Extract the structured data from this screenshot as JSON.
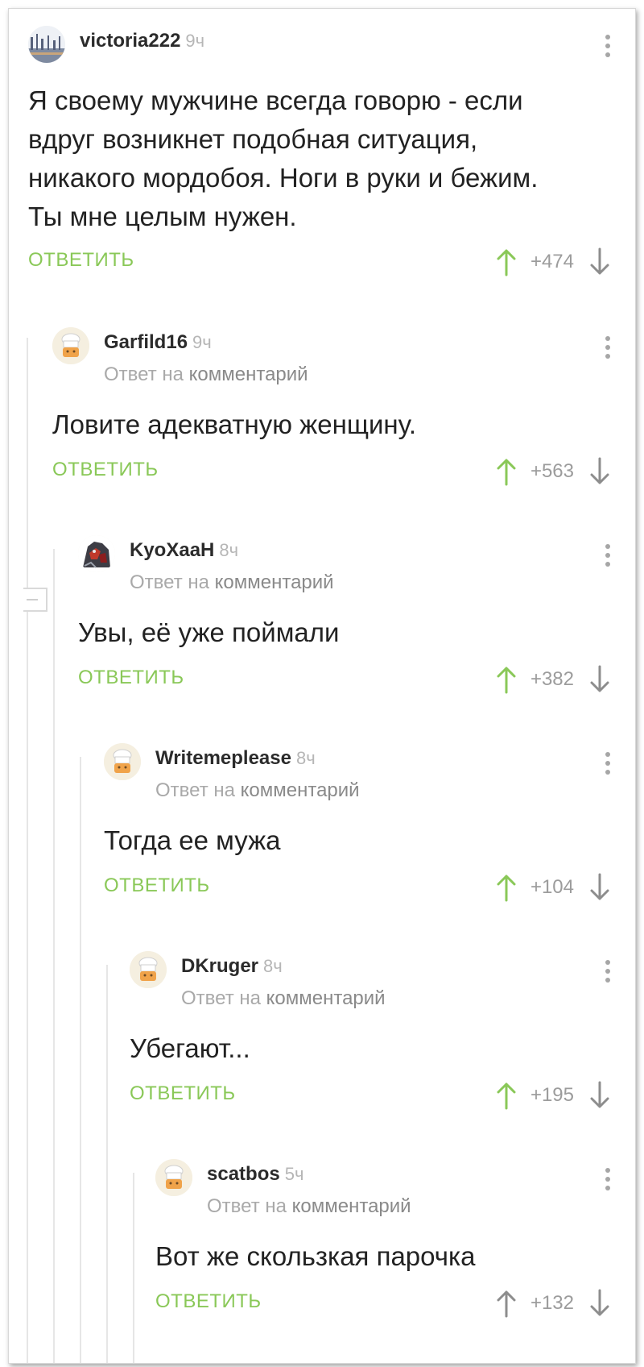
{
  "colors": {
    "accent": "#8ac858",
    "muted": "#a9a9a9",
    "text": "#222222"
  },
  "comments": [
    {
      "user": "victoria222",
      "time": "9ч",
      "reply_prefix": "",
      "reply_link": "",
      "text": "Я своему мужчине всегда говорю - если вдруг возникнет подобная ситуация, никакого мордобоя. Ноги в руки и бежим. Ты мне целым нужен.",
      "reply_label": "ОТВЕТИТЬ",
      "rating": "+474",
      "avatar_icon": "city-avatar-icon",
      "upvoted": true
    },
    {
      "user": "Garfild16",
      "time": "9ч",
      "reply_prefix": "Ответ на",
      "reply_link": "комментарий",
      "text": "Ловите адекватную женщину.",
      "reply_label": "ОТВЕТИТЬ",
      "rating": "+563",
      "avatar_icon": "chef-avatar-icon",
      "upvoted": true
    },
    {
      "user": "KyoXaaH",
      "time": "8ч",
      "reply_prefix": "Ответ на",
      "reply_link": "комментарий",
      "text": "Увы, её уже поймали",
      "reply_label": "ОТВЕТИТЬ",
      "rating": "+382",
      "avatar_icon": "robot-avatar-icon",
      "upvoted": true
    },
    {
      "user": "Writemeplease",
      "time": "8ч",
      "reply_prefix": "Ответ на",
      "reply_link": "комментарий",
      "text": "Тогда ее мужа",
      "reply_label": "ОТВЕТИТЬ",
      "rating": "+104",
      "avatar_icon": "chef-avatar-icon",
      "upvoted": true
    },
    {
      "user": "DKruger",
      "time": "8ч",
      "reply_prefix": "Ответ на",
      "reply_link": "комментарий",
      "text": "Убегают...",
      "reply_label": "ОТВЕТИТЬ",
      "rating": "+195",
      "avatar_icon": "chef-avatar-icon",
      "upvoted": true
    },
    {
      "user": "scatbos",
      "time": "5ч",
      "reply_prefix": "Ответ на",
      "reply_link": "комментарий",
      "text": "Вот же скользкая парочка",
      "reply_label": "ОТВЕТИТЬ",
      "rating": "+132",
      "avatar_icon": "chef-avatar-icon",
      "upvoted": false
    }
  ]
}
